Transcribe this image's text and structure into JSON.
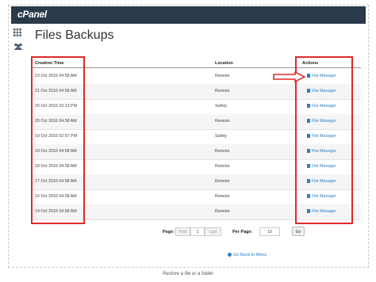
{
  "brand": {
    "logo_text": "cPanel"
  },
  "sidebar": {
    "icons": [
      "grid-icon",
      "users-icon"
    ]
  },
  "page": {
    "title": "Files Backups"
  },
  "table": {
    "headers": {
      "time": "Creation Time",
      "location": "Location",
      "actions": "Actions"
    },
    "rows": [
      {
        "time": "23 Oct 2016 04:58 AM",
        "location": "Remote",
        "action": "File Manager"
      },
      {
        "time": "21 Oct 2016 04:58 AM",
        "location": "Remote",
        "action": "File Manager"
      },
      {
        "time": "20 Oct 2016 03:13 PM",
        "location": "Safety",
        "action": "File Manager"
      },
      {
        "time": "20 Oct 2016 04:58 AM",
        "location": "Remote",
        "action": "File Manager"
      },
      {
        "time": "19 Oct 2016 02:57 PM",
        "location": "Safety",
        "action": "File Manager"
      },
      {
        "time": "19 Oct 2016 04:58 AM",
        "location": "Remote",
        "action": "File Manager"
      },
      {
        "time": "18 Oct 2016 04:58 AM",
        "location": "Remote",
        "action": "File Manager"
      },
      {
        "time": "17 Oct 2016 04:58 AM",
        "location": "Remote",
        "action": "File Manager"
      },
      {
        "time": "16 Oct 2016 04:58 AM",
        "location": "Remote",
        "action": "File Manager"
      },
      {
        "time": "14 Oct 2016 04:58 AM",
        "location": "Remote",
        "action": "File Manager"
      }
    ]
  },
  "pagination": {
    "page_label": "Page:",
    "first_label": "First",
    "current_page": "1",
    "last_label": "Last",
    "per_page_label": "Per Page:",
    "per_page_value": "10",
    "go_label": "Go"
  },
  "footer": {
    "back_link": "Go Back to Menu"
  },
  "caption": "Restore a file or a folder",
  "colors": {
    "highlight": "#e02a2a",
    "link": "#2f7dc0",
    "topbar": "#2b3a4a"
  }
}
